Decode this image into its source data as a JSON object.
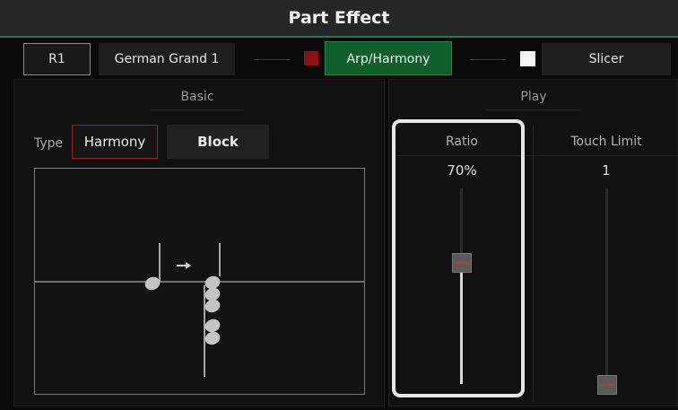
{
  "header": {
    "title": "Part Effect"
  },
  "toolbar": {
    "part_label": "R1",
    "voice_label": "German Grand 1",
    "arp_harmony_label": "Arp/Harmony",
    "slicer_label": "Slicer",
    "arp_indicator_color": "#8a1414",
    "slicer_indicator_color": "#f5f5f5"
  },
  "basic": {
    "title": "Basic",
    "type_label": "Type",
    "type_options": [
      "Harmony",
      "Block"
    ],
    "selected_type": "Harmony"
  },
  "play": {
    "title": "Play",
    "columns": [
      {
        "name": "Ratio",
        "value": "70%",
        "level": 0.7,
        "highlighted": true
      },
      {
        "name": "Touch Limit",
        "value": "1",
        "level": 0.0
      }
    ]
  },
  "icons": [
    "music-note-icon",
    "right-arrow-icon",
    "chord-notes-icon"
  ],
  "colors": {
    "accent_green": "#0f5e2c",
    "selected_border": "#a82222",
    "thumb_mark": "#c43a3a"
  }
}
